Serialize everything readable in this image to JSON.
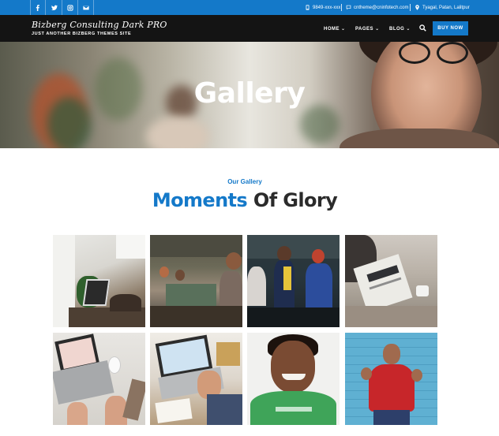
{
  "topbar": {
    "social_icons": [
      "facebook-icon",
      "twitter-icon",
      "instagram-icon",
      "email-icon"
    ],
    "phone": "9849-xxx-xxx",
    "email": "cntheme@cninfotech.com",
    "location": "Tyagal, Patan, Lalitpur"
  },
  "header": {
    "brand": "Bizberg Consulting Dark PRO",
    "tagline": "JUST ANOTHER BIZBERG THEMES SITE",
    "nav": [
      {
        "label": "HOME"
      },
      {
        "label": "PAGES"
      },
      {
        "label": "BLOG"
      }
    ],
    "buy_label": "BUY NOW"
  },
  "hero": {
    "title": "Gallery"
  },
  "section": {
    "eyebrow": "Our Gallery",
    "heading_highlight": "Moments",
    "heading_rest": "Of Glory"
  },
  "colors": {
    "accent": "#1479c9",
    "nav_bg": "#141414",
    "heading_dark": "#2b2b2b"
  }
}
